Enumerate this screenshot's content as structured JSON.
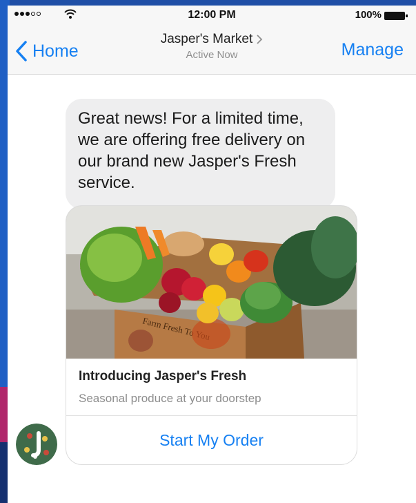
{
  "status_bar": {
    "time": "12:00 PM",
    "battery": "100%",
    "signal_icon": "signal-dots-icon",
    "wifi_icon": "wifi-icon",
    "battery_icon": "battery-full-icon"
  },
  "header": {
    "back_label": "Home",
    "title": "Jasper's Market",
    "subtitle": "Active Now",
    "action_label": "Manage",
    "back_icon": "chevron-left-icon",
    "title_icon": "chevron-right-icon"
  },
  "message": {
    "text": "Great news! For a limited time, we are offering free delivery on our brand new Jasper's Fresh service."
  },
  "card": {
    "image_icon": "produce-box-image",
    "image_box_text": "Farm Fresh To You",
    "title": "Introducing Jasper's Fresh",
    "subtitle": "Seasonal produce at your doorstep",
    "button_label": "Start My Order"
  },
  "avatar_icon": "jaspers-market-avatar",
  "colors": {
    "accent": "#1680f2",
    "bubble": "#eeeeef",
    "screen_frame": "#1f4fa6"
  }
}
